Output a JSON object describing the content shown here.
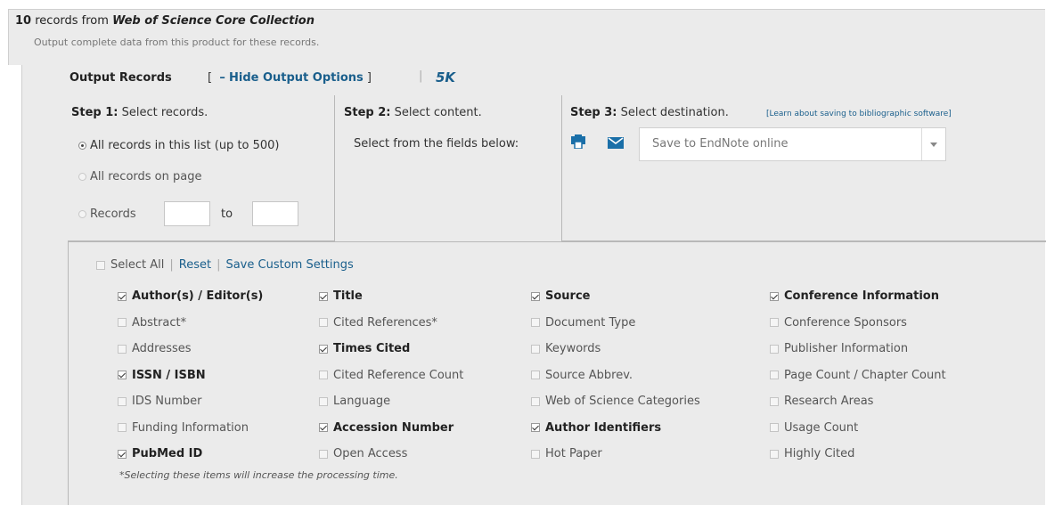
{
  "header": {
    "count": "10",
    "records_from": "records from",
    "collection": "Web of Science Core Collection",
    "subtitle": "Output complete data from this product for these records."
  },
  "output": {
    "title": "Output Records",
    "bracket_open": "[",
    "dash": "–",
    "hide_label": "Hide Output Options",
    "bracket_close": "]",
    "sep": "|",
    "badge": "5K"
  },
  "step1": {
    "label_bold": "Step 1:",
    "label_rest": " Select records.",
    "options": [
      {
        "label": "All records in this list (up to 500)",
        "selected": true
      },
      {
        "label": "All records on page",
        "selected": false
      },
      {
        "label": "Records",
        "selected": false
      }
    ],
    "to_label": "to",
    "from_value": "",
    "to_value": ""
  },
  "step2": {
    "label_bold": "Step 2:",
    "label_rest": " Select content.",
    "instruction": "Select from the fields below:"
  },
  "step3": {
    "label_bold": "Step 3:",
    "label_rest": " Select destination.",
    "learn_link": "[Learn about saving to bibliographic software]",
    "destination_value": "Save to EndNote online",
    "icons": [
      "print-icon",
      "mail-icon"
    ]
  },
  "fields": {
    "select_all": "Select All",
    "reset": "Reset",
    "save_custom": "Save Custom Settings",
    "bar": "|",
    "columns": [
      [
        {
          "label": "Author(s) / Editor(s)",
          "checked": true
        },
        {
          "label": "Abstract*",
          "checked": false
        },
        {
          "label": "Addresses",
          "checked": false
        },
        {
          "label": "ISSN / ISBN",
          "checked": true
        },
        {
          "label": "IDS Number",
          "checked": false
        },
        {
          "label": "Funding Information",
          "checked": false
        },
        {
          "label": "PubMed ID",
          "checked": true
        }
      ],
      [
        {
          "label": "Title",
          "checked": true
        },
        {
          "label": "Cited References*",
          "checked": false
        },
        {
          "label": "Times Cited",
          "checked": true
        },
        {
          "label": "Cited Reference Count",
          "checked": false
        },
        {
          "label": "Language",
          "checked": false
        },
        {
          "label": "Accession Number",
          "checked": true
        },
        {
          "label": "Open Access",
          "checked": false
        }
      ],
      [
        {
          "label": "Source",
          "checked": true
        },
        {
          "label": "Document Type",
          "checked": false
        },
        {
          "label": "Keywords",
          "checked": false
        },
        {
          "label": "Source Abbrev.",
          "checked": false
        },
        {
          "label": "Web of Science Categories",
          "checked": false
        },
        {
          "label": "Author Identifiers",
          "checked": true
        },
        {
          "label": "Hot Paper",
          "checked": false
        }
      ],
      [
        {
          "label": "Conference Information",
          "checked": true
        },
        {
          "label": "Conference Sponsors",
          "checked": false
        },
        {
          "label": "Publisher Information",
          "checked": false
        },
        {
          "label": "Page Count / Chapter Count",
          "checked": false
        },
        {
          "label": "Research Areas",
          "checked": false
        },
        {
          "label": "Usage Count",
          "checked": false
        },
        {
          "label": "Highly Cited",
          "checked": false
        }
      ]
    ],
    "note": "*Selecting these items will increase the processing time."
  },
  "colors": {
    "link": "#1a5f8c",
    "panel_bg": "#ebebeb",
    "print_icon": "#1a6fa8",
    "mail_icon": "#1a6fa8"
  }
}
